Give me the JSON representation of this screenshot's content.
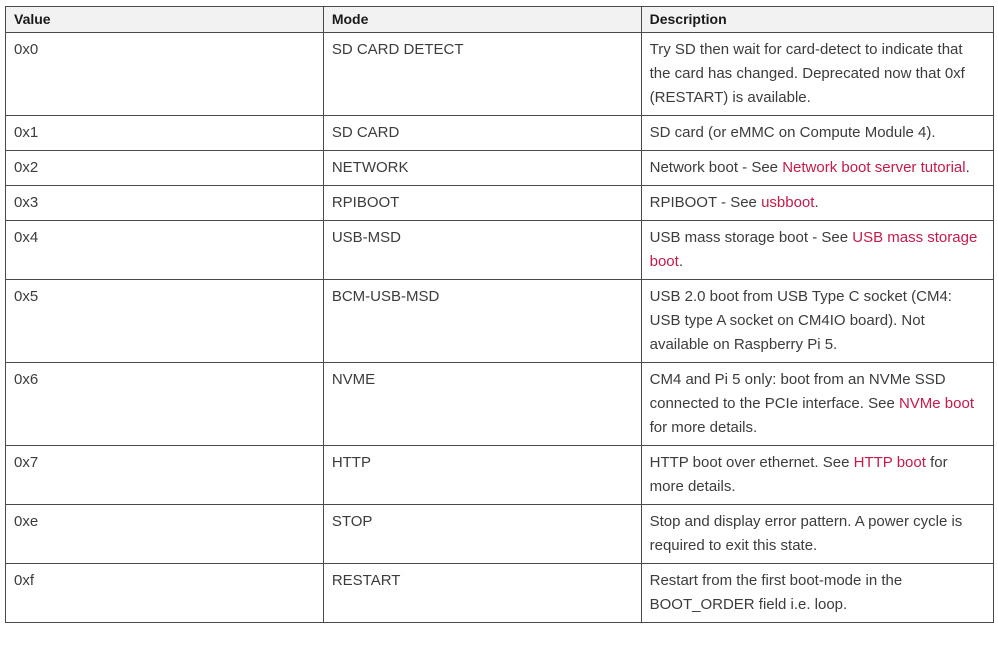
{
  "table": {
    "headers": {
      "value": "Value",
      "mode": "Mode",
      "description": "Description"
    },
    "rows": [
      {
        "value": "0x0",
        "mode": "SD CARD DETECT",
        "desc": {
          "pre": "Try SD then wait for card-detect to indicate that the card has changed. Deprecated now that 0xf (RESTART) is available.",
          "link": "",
          "post": ""
        }
      },
      {
        "value": "0x1",
        "mode": "SD CARD",
        "desc": {
          "pre": "SD card (or eMMC on Compute Module 4).",
          "link": "",
          "post": ""
        }
      },
      {
        "value": "0x2",
        "mode": "NETWORK",
        "desc": {
          "pre": "Network boot - See ",
          "link": "Network boot server tutorial",
          "post": "."
        }
      },
      {
        "value": "0x3",
        "mode": "RPIBOOT",
        "desc": {
          "pre": "RPIBOOT - See ",
          "link": "usbboot",
          "post": "."
        }
      },
      {
        "value": "0x4",
        "mode": "USB-MSD",
        "desc": {
          "pre": "USB mass storage boot - See ",
          "link": "USB mass storage boot",
          "post": "."
        }
      },
      {
        "value": "0x5",
        "mode": "BCM-USB-MSD",
        "desc": {
          "pre": "USB 2.0 boot from USB Type C socket (CM4: USB type A socket on CM4IO board). Not available on Raspberry Pi 5.",
          "link": "",
          "post": ""
        }
      },
      {
        "value": "0x6",
        "mode": "NVME",
        "desc": {
          "pre": "CM4 and Pi 5 only: boot from an NVMe SSD connected to the PCIe interface. See ",
          "link": "NVMe boot",
          "post": " for more details."
        }
      },
      {
        "value": "0x7",
        "mode": "HTTP",
        "desc": {
          "pre": "HTTP boot over ethernet. See ",
          "link": "HTTP boot",
          "post": " for more details."
        }
      },
      {
        "value": "0xe",
        "mode": "STOP",
        "desc": {
          "pre": "Stop and display error pattern. A power cycle is required to exit this state.",
          "link": "",
          "post": ""
        }
      },
      {
        "value": "0xf",
        "mode": "RESTART",
        "desc": {
          "pre": "Restart from the first boot-mode in the BOOT_ORDER field i.e. loop.",
          "link": "",
          "post": ""
        }
      }
    ]
  },
  "colors": {
    "link": "#c51a4a",
    "header_bg": "#f2f2f2",
    "border": "#4a4a4a"
  }
}
